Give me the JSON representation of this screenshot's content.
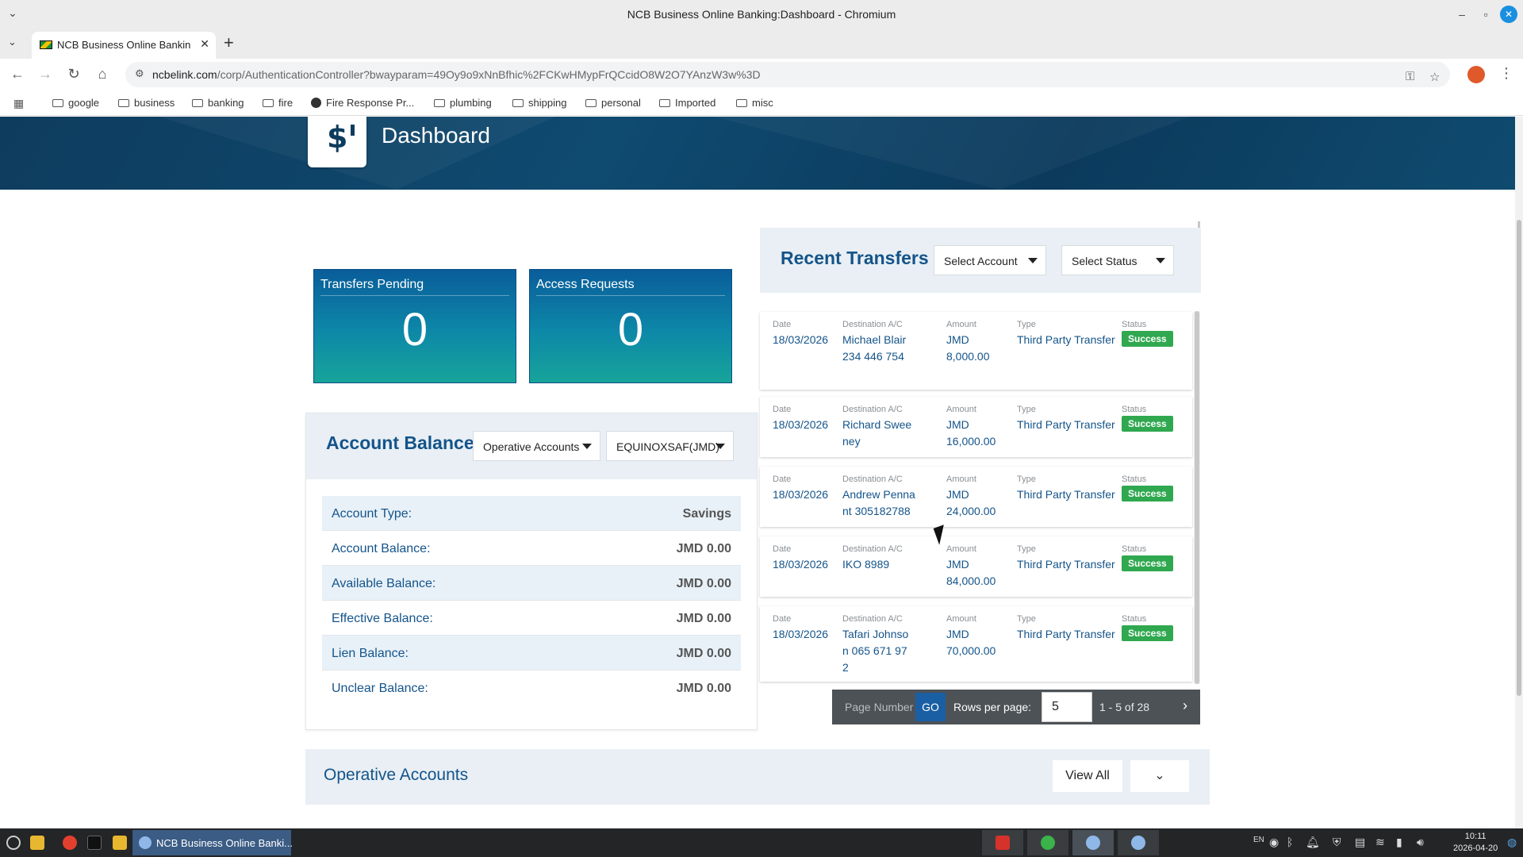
{
  "window": {
    "title": "NCB Business Online Banking:Dashboard - Chromium"
  },
  "tab": {
    "title": "NCB Business Online Banking:Dashboard"
  },
  "address": {
    "host": "ncbelink.com",
    "path": "/corp/AuthenticationController?bwayparam=49Oy9o9xNnBfhic%2FCKwHMypFrQCcidO8W2O7YAnzW3w%3D"
  },
  "bookmarks": [
    "google",
    "business",
    "banking",
    "fire",
    "Fire Response Pr...",
    "plumbing",
    "shipping",
    "personal",
    "Imported",
    "misc"
  ],
  "banner": {
    "title": "Dashboard",
    "logo_symbol": "$"
  },
  "tiles": [
    {
      "label": "Transfers Pending",
      "value": "0"
    },
    {
      "label": "Access Requests",
      "value": "0"
    }
  ],
  "balances": {
    "title": "Account Balances",
    "account_group": "Operative Accounts",
    "account": "EQUINOXSAF(JMD)",
    "rows": [
      {
        "label": "Account Type:",
        "value": "Savings"
      },
      {
        "label": "Account Balance:",
        "value": "JMD 0.00"
      },
      {
        "label": "Available Balance:",
        "value": "JMD 0.00"
      },
      {
        "label": "Effective Balance:",
        "value": "JMD 0.00"
      },
      {
        "label": "Lien Balance:",
        "value": "JMD 0.00"
      },
      {
        "label": "Unclear Balance:",
        "value": "JMD 0.00"
      }
    ]
  },
  "transfers": {
    "title": "Recent Transfers",
    "select_account": "Select Account",
    "select_status": "Select Status",
    "headers": {
      "date": "Date",
      "destination": "Destination A/C",
      "amount": "Amount",
      "type": "Type",
      "status": "Status"
    },
    "items": [
      {
        "date": "18/03/2026",
        "destination": "Michael Blair 234 446 754",
        "amount": "JMD 8,000.00",
        "type": "Third Party Transfer",
        "status": "Success"
      },
      {
        "date": "18/03/2026",
        "destination": "Richard Sweeney",
        "amount": "JMD 16,000.00",
        "type": "Third Party Transfer",
        "status": "Success"
      },
      {
        "date": "18/03/2026",
        "destination": "Andrew Pennant 305182788",
        "amount": "JMD 24,000.00",
        "type": "Third Party Transfer",
        "status": "Success"
      },
      {
        "date": "18/03/2026",
        "destination": "IKO 8989",
        "amount": "JMD 84,000.00",
        "type": "Third Party Transfer",
        "status": "Success"
      },
      {
        "date": "18/03/2026",
        "destination": "Tafari Johnson 065 671 972",
        "amount": "JMD 70,000.00",
        "type": "Third Party Transfer",
        "status": "Success"
      }
    ],
    "pager": {
      "page_number_label": "Page Number",
      "go": "GO",
      "rows_label": "Rows per page:",
      "rows_value": "5",
      "range": "1 - 5 of 28"
    }
  },
  "operative": {
    "title": "Operative Accounts",
    "view_all": "View All"
  },
  "taskbar": {
    "app_title": "NCB Business Online Banki...",
    "clock_time": "10:11",
    "clock_date": "2026-04-20",
    "lang": "EN"
  },
  "colors": {
    "brand_blue": "#14548a",
    "banner": "#0e3c5e",
    "success": "#2fa84f",
    "pager": "#4d5257",
    "go": "#1a5fa3"
  },
  "icons": [
    "menu-chevron-icon",
    "back-icon",
    "forward-icon",
    "reload-icon",
    "home-icon",
    "site-info-icon",
    "password-key-icon",
    "star-icon",
    "apps-icon",
    "folder-icon",
    "globe-icon",
    "caret-down-icon",
    "next-page-icon",
    "chevron-down-icon"
  ]
}
